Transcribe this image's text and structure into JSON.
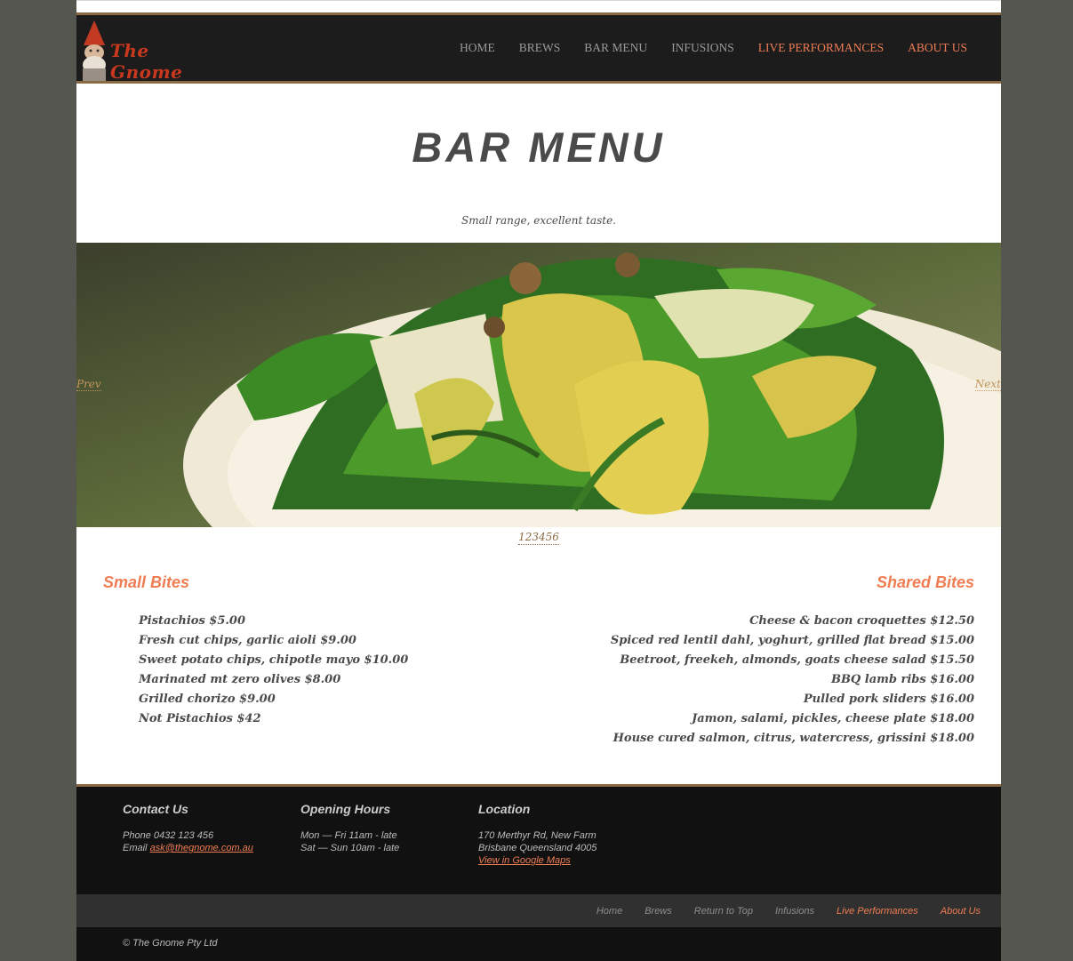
{
  "site": {
    "logo_text": "The Gnome"
  },
  "nav": {
    "items": [
      {
        "label": "HOME",
        "active": false
      },
      {
        "label": "BREWS",
        "active": false
      },
      {
        "label": "BAR MENU",
        "active": false
      },
      {
        "label": "INFUSIONS",
        "active": false
      },
      {
        "label": "LIVE PERFORMANCES",
        "active": true
      },
      {
        "label": "ABOUT US",
        "active": true
      }
    ]
  },
  "page": {
    "title": "BAR MENU",
    "tagline": "Small range, excellent taste."
  },
  "slider": {
    "prev_label": "Prev",
    "next_label": "Next",
    "pager": "123456",
    "image_icon": "salad-photo"
  },
  "menu": {
    "small_bites": {
      "heading": "Small Bites",
      "items": [
        "Pistachios $5.00",
        "Fresh cut chips, garlic aioli $9.00",
        "Sweet potato chips, chipotle mayo $10.00",
        "Marinated mt zero olives $8.00",
        "Grilled chorizo $9.00",
        "Not Pistachios $42"
      ]
    },
    "shared_bites": {
      "heading": "Shared Bites",
      "items": [
        "Cheese & bacon croquettes $12.50",
        "Spiced red lentil dahl, yoghurt, grilled flat bread $15.00",
        "Beetroot, freekeh, almonds, goats cheese salad $15.50",
        "BBQ lamb ribs $16.00",
        "Pulled pork sliders $16.00",
        "Jamon, salami, pickles, cheese plate $18.00",
        "House cured salmon, citrus, watercress, grissini $18.00"
      ]
    }
  },
  "footer": {
    "contact": {
      "heading": "Contact Us",
      "phone": "Phone 0432 123 456",
      "email_prefix": "Email ",
      "email": "ask@thegnome.com.au"
    },
    "hours": {
      "heading": "Opening Hours",
      "weekday": "Mon — Fri 11am - late",
      "weekend": "Sat — Sun 10am - late"
    },
    "location": {
      "heading": "Location",
      "line1": "170 Merthyr Rd, New Farm",
      "line2": "Brisbane Queensland 4005",
      "map_link": "View in Google Maps"
    },
    "nav": [
      {
        "label": "Home",
        "active": false
      },
      {
        "label": "Brews",
        "active": false
      },
      {
        "label": "Return to Top",
        "active": false
      },
      {
        "label": "Infusions",
        "active": false
      },
      {
        "label": "Live Performances",
        "active": true
      },
      {
        "label": "About Us",
        "active": true
      }
    ],
    "copyright": "© The Gnome Pty Ltd"
  },
  "colors": {
    "accent": "#ef7d53",
    "brown": "#8a6a43",
    "outer_bg": "#54564f",
    "header_bg": "#1c1c1c"
  }
}
